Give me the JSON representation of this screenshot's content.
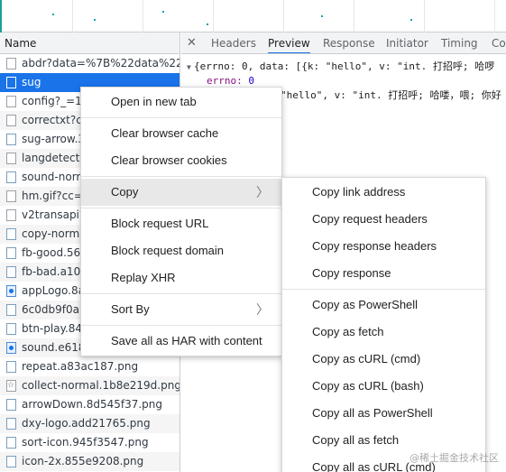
{
  "request_list": {
    "header": "Name",
    "rows": [
      {
        "name": "abdr?data=%7B%22data%22%",
        "icon": "file-icon"
      },
      {
        "name": "sug",
        "icon": "file-icon",
        "selected": true
      },
      {
        "name": "config?_=16",
        "icon": "file-icon"
      },
      {
        "name": "correctxt?ca",
        "icon": "file-icon"
      },
      {
        "name": "sug-arrow.3a",
        "icon": "image-file-icon"
      },
      {
        "name": "langdetect",
        "icon": "file-icon"
      },
      {
        "name": "sound-norm",
        "icon": "image-file-icon"
      },
      {
        "name": "hm.gif?cc=1",
        "icon": "file-icon"
      },
      {
        "name": "v2transapi?f",
        "icon": "file-icon"
      },
      {
        "name": "copy-norma",
        "icon": "image-file-icon"
      },
      {
        "name": "fb-good.564",
        "icon": "image-file-icon"
      },
      {
        "name": "fb-bad.a10d",
        "icon": "image-file-icon"
      },
      {
        "name": "appLogo.8a0",
        "icon": "app-logo-icon"
      },
      {
        "name": "6c0db9f0a5c",
        "icon": "image-file-icon"
      },
      {
        "name": "btn-play.843",
        "icon": "image-file-icon"
      },
      {
        "name": "sound.e6186",
        "icon": "app-logo-icon"
      },
      {
        "name": "repeat.a83ac187.png",
        "icon": "image-file-icon"
      },
      {
        "name": "collect-normal.1b8e219d.png",
        "icon": "star-file-icon"
      },
      {
        "name": "arrowDown.8d545f37.png",
        "icon": "image-file-icon"
      },
      {
        "name": "dxy-logo.add21765.png",
        "icon": "image-file-icon"
      },
      {
        "name": "sort-icon.945f3547.png",
        "icon": "image-file-icon"
      },
      {
        "name": "icon-2x.855e9208.png",
        "icon": "image-file-icon"
      }
    ]
  },
  "details": {
    "close_glyph": "✕",
    "tabs": [
      "Headers",
      "Preview",
      "Response",
      "Initiator",
      "Timing",
      "Coo"
    ],
    "active_tab": "Preview",
    "preview": {
      "line1": "{errno: 0, data: [{k: \"hello\", v: \"int. 打招呼; 哈啰",
      "line2_key": "errno",
      "line2_value": "0",
      "line3": "\"hello\", v: \"int. 打招呼; 哈喽，喂; 你好"
    }
  },
  "context_menu": {
    "items": [
      {
        "label": "Open in new tab"
      },
      {
        "sep": true
      },
      {
        "label": "Clear browser cache"
      },
      {
        "label": "Clear browser cookies"
      },
      {
        "sep": true
      },
      {
        "label": "Copy",
        "submenu": true,
        "hover": true
      },
      {
        "sep": true
      },
      {
        "label": "Block request URL"
      },
      {
        "label": "Block request domain"
      },
      {
        "label": "Replay XHR"
      },
      {
        "sep": true
      },
      {
        "label": "Sort By",
        "submenu": true
      },
      {
        "sep": true
      },
      {
        "label": "Save all as HAR with content"
      }
    ]
  },
  "copy_submenu": {
    "items": [
      {
        "label": "Copy link address"
      },
      {
        "label": "Copy request headers"
      },
      {
        "label": "Copy response headers"
      },
      {
        "label": "Copy response"
      },
      {
        "sep": true
      },
      {
        "label": "Copy as PowerShell"
      },
      {
        "label": "Copy as fetch"
      },
      {
        "label": "Copy as cURL (cmd)"
      },
      {
        "label": "Copy as cURL (bash)"
      },
      {
        "label": "Copy all as PowerShell"
      },
      {
        "label": "Copy all as fetch"
      },
      {
        "label": "Copy all as cURL (cmd)"
      }
    ]
  },
  "submenu_arrow": "〉",
  "watermark": "@稀土掘金技术社区",
  "colors": {
    "selection": "#1a73e8",
    "active_tab_underline": "#1a73e8",
    "menu_hover": "#e8e8e8"
  }
}
